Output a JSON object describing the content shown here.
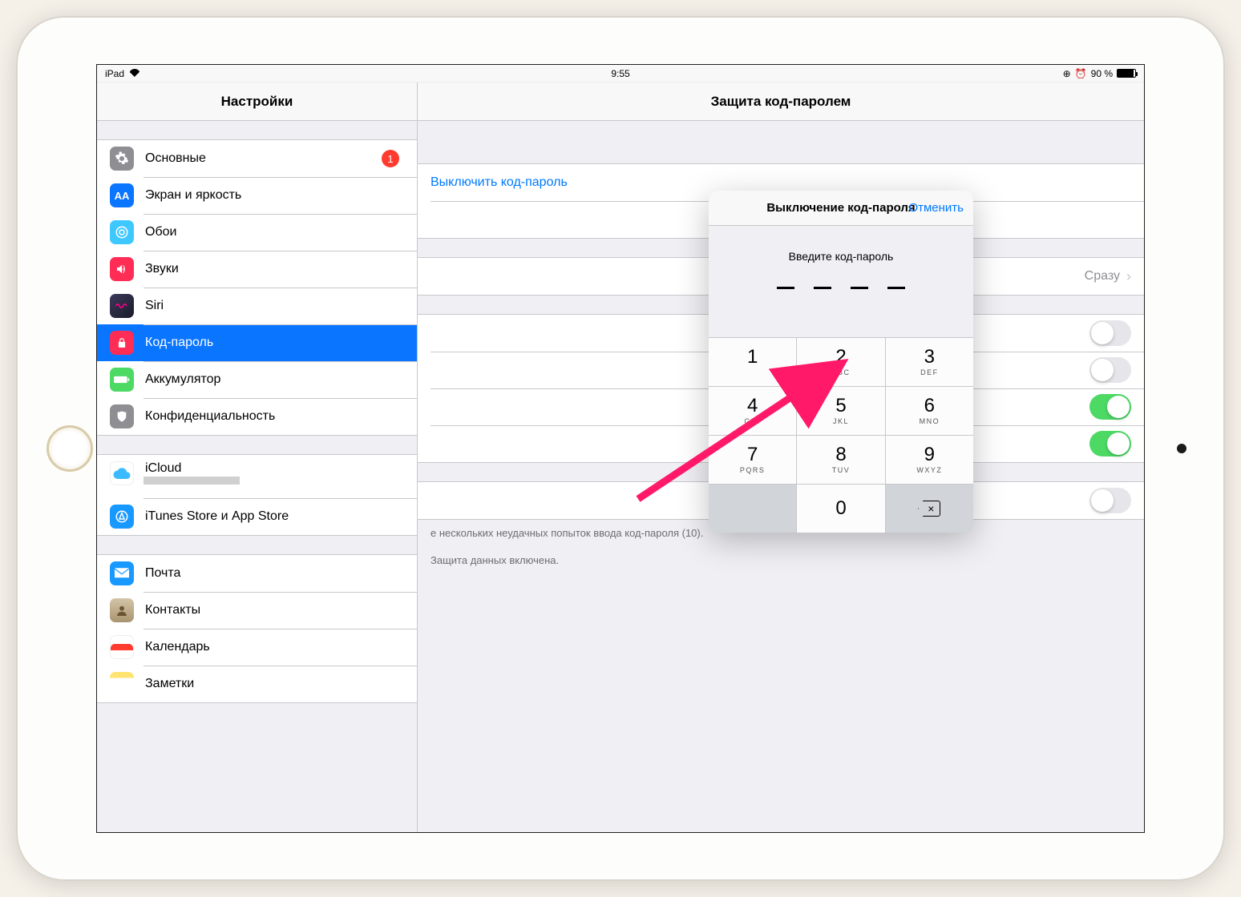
{
  "statusBar": {
    "device": "iPad",
    "time": "9:55",
    "battery": "90 %"
  },
  "sidebar": {
    "title": "Настройки",
    "items": {
      "general": {
        "label": "Основные",
        "badge": "1"
      },
      "display": {
        "label": "Экран и яркость"
      },
      "wallpaper": {
        "label": "Обои"
      },
      "sounds": {
        "label": "Звуки"
      },
      "siri": {
        "label": "Siri"
      },
      "passcode": {
        "label": "Код-пароль"
      },
      "battery": {
        "label": "Аккумулятор"
      },
      "privacy": {
        "label": "Конфиденциальность"
      },
      "icloud": {
        "label": "iCloud"
      },
      "itunes": {
        "label": "iTunes Store и App Store"
      },
      "mail": {
        "label": "Почта"
      },
      "contacts": {
        "label": "Контакты"
      },
      "calendar": {
        "label": "Календарь"
      },
      "notes": {
        "label": "Заметки"
      }
    }
  },
  "main": {
    "title": "Защита код-паролем",
    "turnOff": "Выключить код-пароль",
    "requireValue": "Сразу",
    "footer1": "е нескольких неудачных попыток ввода код-пароля (10).",
    "footer2": "Защита данных включена."
  },
  "modal": {
    "title": "Выключение код-пароля",
    "cancel": "Отменить",
    "prompt": "Введите код-пароль"
  },
  "keypad": {
    "k1": "1",
    "k2": "2",
    "k2l": "ABC",
    "k3": "3",
    "k3l": "DEF",
    "k4": "4",
    "k4l": "GHI",
    "k5": "5",
    "k5l": "JKL",
    "k6": "6",
    "k6l": "MNO",
    "k7": "7",
    "k7l": "PQRS",
    "k8": "8",
    "k8l": "TUV",
    "k9": "9",
    "k9l": "WXYZ",
    "k0": "0"
  }
}
